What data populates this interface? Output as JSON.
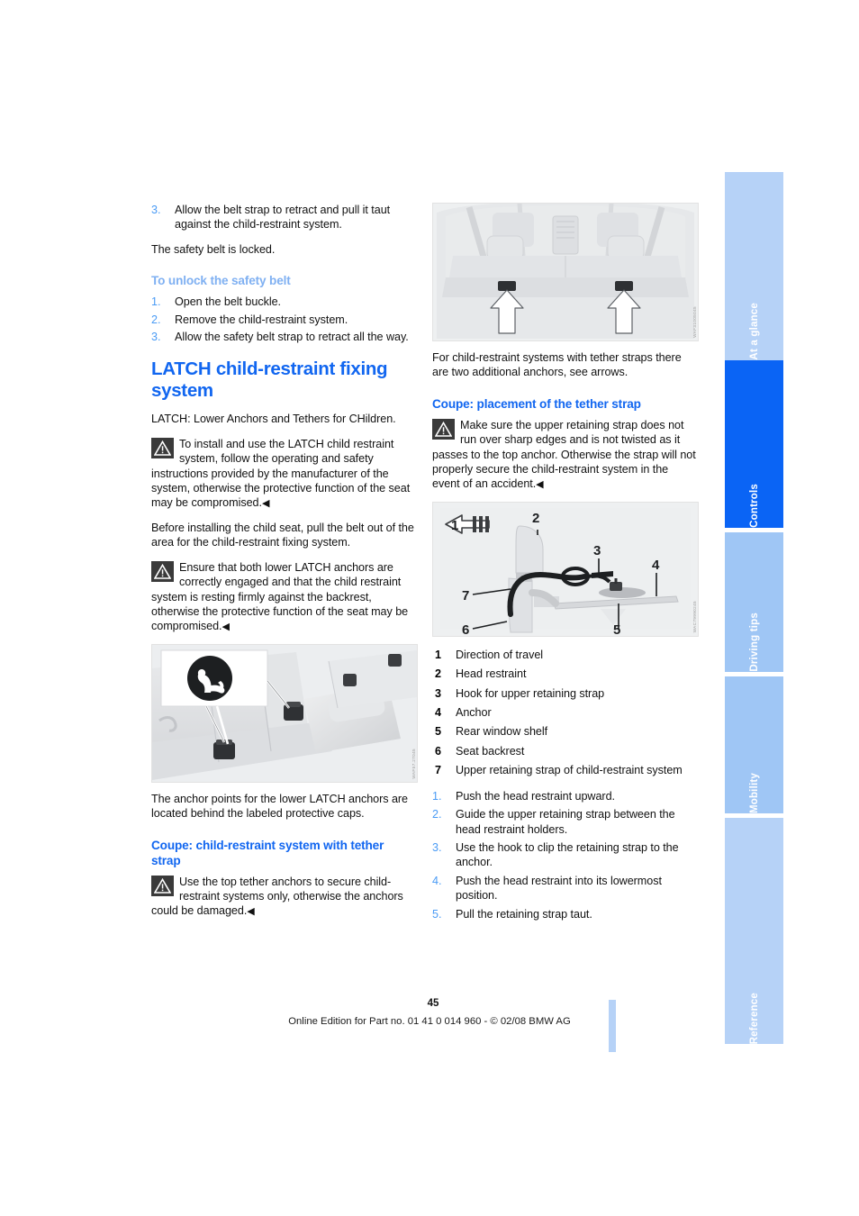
{
  "document": {
    "page_number": "45",
    "footer_text": "Online Edition for Part no. 01 41 0 014 960 - © 02/08 BMW AG"
  },
  "tabs": [
    {
      "label": "At a glance",
      "active": false
    },
    {
      "label": "Controls",
      "active": true
    },
    {
      "label": "Driving tips",
      "active": false
    },
    {
      "label": "Mobility",
      "active": false
    },
    {
      "label": "Reference",
      "active": false
    }
  ],
  "colors": {
    "heading_blue": "#1166f0",
    "light_blue_heading": "#7fb0f2",
    "list_number_blue": "#4a9bf5",
    "tab_active": "#0a64f5",
    "tab_inactive": "#b6d2f7",
    "tab_inactive_dark": "#9fc6f5"
  },
  "left_column": {
    "top_list": [
      {
        "num": "3.",
        "text": "Allow the belt strap to retract and pull it taut against the child-restraint system."
      }
    ],
    "locked_note": "The safety belt is locked.",
    "unlock_heading": "To unlock the safety belt",
    "unlock_steps": [
      {
        "num": "1.",
        "text": "Open the belt buckle."
      },
      {
        "num": "2.",
        "text": "Remove the child-restraint system."
      },
      {
        "num": "3.",
        "text": "Allow the safety belt strap to retract all the way."
      }
    ],
    "main_heading": "LATCH child-restraint fixing system",
    "latch_definition": "LATCH: Lower Anchors and Tethers for CHildren.",
    "warning_install": "To install and use the LATCH child restraint system, follow the operating and safety instructions provided by the manufacturer of the system, otherwise the protective function of the seat may be compromised.",
    "before_install": "Before installing the child seat, pull the belt out of the area for the child-restraint fixing system.",
    "warning_anchors": "Ensure that both lower LATCH anchors are correctly engaged and that the child restraint system is resting firmly against the backrest, otherwise the protective function of the seat may be compromised.",
    "figure_anchors": {
      "name": "rear seat lower LATCH anchor caps",
      "code": "WAF57.27045"
    },
    "anchor_caption": "The anchor points for the lower LATCH anchors are located behind the labeled protective caps.",
    "coupe_heading": "Coupe: child-restraint system with tether strap",
    "warning_top_tether": "Use the top tether anchors to secure child-restraint systems only, otherwise the anchors could be damaged."
  },
  "right_column": {
    "figure_shelf": {
      "name": "rear window shelf tether anchors",
      "code": "WAF31005045"
    },
    "shelf_caption": "For child-restraint systems with tether straps there are two additional anchors, see arrows.",
    "placement_heading": "Coupe: placement of the tether strap",
    "warning_strap": "Make sure the upper retaining strap does not run over sharp edges and is not twisted as it passes to the top anchor. Otherwise the strap will not properly secure the child-restraint system in the event of an accident.",
    "figure_tether": {
      "name": "tether strap routing diagram",
      "code": "WAC79990245",
      "callouts": [
        "1",
        "2",
        "3",
        "4",
        "5",
        "6",
        "7"
      ]
    },
    "legend": [
      {
        "num": "1",
        "text": "Direction of travel"
      },
      {
        "num": "2",
        "text": "Head restraint"
      },
      {
        "num": "3",
        "text": "Hook for upper retaining strap"
      },
      {
        "num": "4",
        "text": "Anchor"
      },
      {
        "num": "5",
        "text": "Rear window shelf"
      },
      {
        "num": "6",
        "text": "Seat backrest"
      },
      {
        "num": "7",
        "text": "Upper retaining strap of child-restraint system"
      }
    ],
    "steps": [
      {
        "num": "1.",
        "text": "Push the head restraint upward."
      },
      {
        "num": "2.",
        "text": "Guide the upper retaining strap between the head restraint holders."
      },
      {
        "num": "3.",
        "text": "Use the hook to clip the retaining strap to the anchor."
      },
      {
        "num": "4.",
        "text": "Push the head restraint into its lowermost position."
      },
      {
        "num": "5.",
        "text": "Pull the retaining strap taut."
      }
    ]
  }
}
